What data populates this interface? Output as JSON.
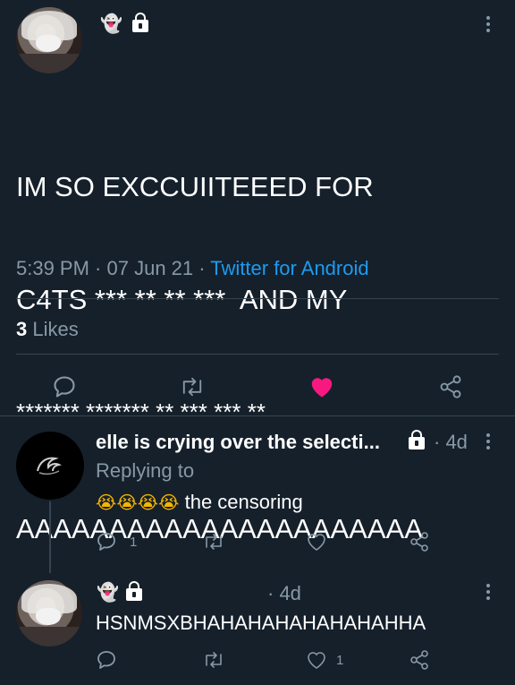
{
  "main_tweet": {
    "badge_emoji": "👻",
    "text_line1": "IM SO EXCCUIITEEED FOR",
    "text_line2": "C4TS *** ** ** ***  AND MY",
    "text_line3": "******* ******* ** *** *** **",
    "text_line4": "AAAAAAAAAAAAAAAAAAAAAA",
    "time": "5:39 PM",
    "sep1": " · ",
    "date": "07 Jun 21",
    "sep2": " · ",
    "source": "Twitter for Android",
    "likes_count": "3",
    "likes_label": " Likes",
    "liked": true
  },
  "reply1": {
    "name": "elle is crying over the selecti...",
    "time": "· 4d",
    "replying_to": "Replying to",
    "emojis": "😭😭😭😭",
    "text": " the censoring",
    "reply_count": "1"
  },
  "reply2": {
    "badge_emoji": "👻",
    "time": "· 4d",
    "text": "HSNMSXBHAHAHAHAHAHAHAHHA",
    "like_count": "1"
  },
  "colors": {
    "background": "#15202b",
    "muted": "#8899a6",
    "link": "#1d9bf0",
    "like": "#f91880",
    "divider": "#38444d"
  },
  "icons": {
    "reply": "reply-icon",
    "retweet": "retweet-icon",
    "like": "heart-icon",
    "share": "share-icon",
    "lock": "lock-icon",
    "more": "more-icon"
  }
}
